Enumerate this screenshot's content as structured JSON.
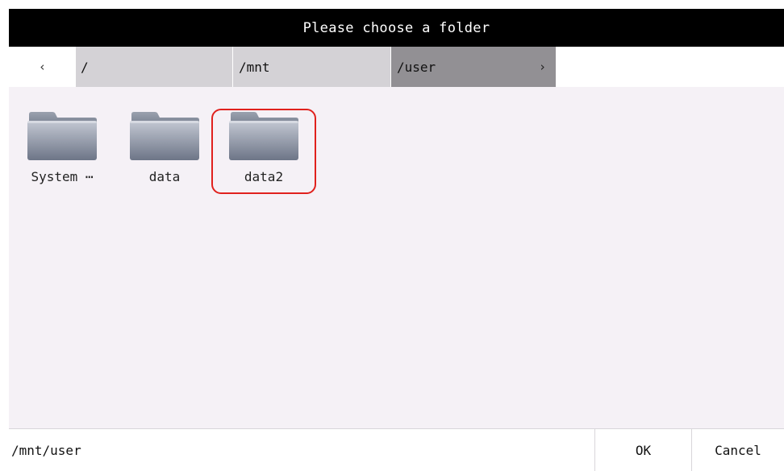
{
  "dialog": {
    "title": "Please choose a folder"
  },
  "breadcrumb": {
    "back_icon": "chevron-left-icon",
    "back_glyph": "‹",
    "forward_icon": "chevron-right-icon",
    "forward_glyph": "›",
    "items": [
      {
        "label": "/"
      },
      {
        "label": "/mnt"
      },
      {
        "label": "/user",
        "active": true
      }
    ]
  },
  "folders": [
    {
      "label": "System ⋯",
      "icon": "folder-icon"
    },
    {
      "label": "data",
      "icon": "folder-icon"
    },
    {
      "label": "data2",
      "icon": "folder-icon",
      "selected": true
    }
  ],
  "footer": {
    "current_path": "/mnt/user",
    "ok_label": "OK",
    "cancel_label": "Cancel"
  },
  "colors": {
    "titlebar": "#000000",
    "content_bg": "#f5f1f6",
    "crumb_bg": "#d4d2d6",
    "crumb_active_bg": "#929094",
    "selection_ring": "#e0211d"
  }
}
